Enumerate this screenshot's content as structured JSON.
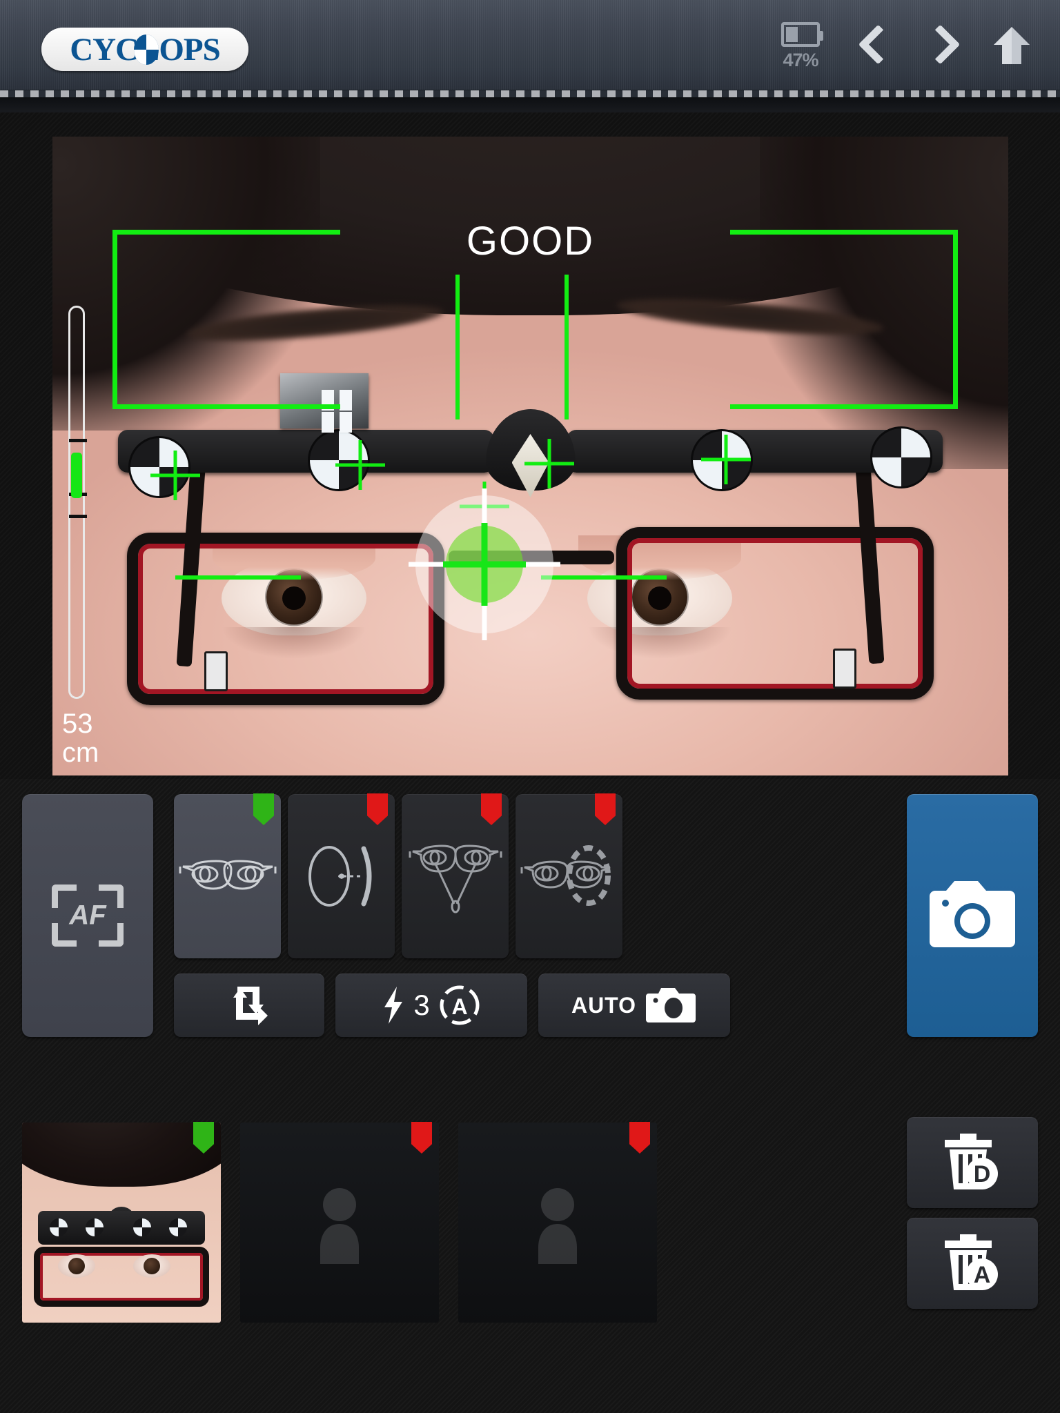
{
  "header": {
    "logo_text": "CYCLOPS",
    "logo_icon": "cyclops-eye-logo",
    "battery": {
      "icon": "battery-icon",
      "percent_label": "47%",
      "fill_percent": 47
    },
    "nav_prev_icon": "chevron-left-icon",
    "nav_next_icon": "chevron-right-icon",
    "home_icon": "home-icon"
  },
  "viewfinder": {
    "status_label": "GOOD",
    "distance_value": "53",
    "distance_unit": "cm",
    "overlay_color": "#12ed12",
    "target_icon": "crosshair-target",
    "gauge_icon": "distance-gauge",
    "frame_icon": "detection-bracket-frame"
  },
  "controls": {
    "af_label": "AF",
    "af_icon": "autofocus-frame-icon",
    "capture_icon": "camera-icon",
    "modes": [
      {
        "icon": "glasses-front-eyes-icon",
        "status": "green",
        "selected": true
      },
      {
        "icon": "lens-profile-icon",
        "status": "red",
        "selected": false
      },
      {
        "icon": "glasses-convergence-near-icon",
        "status": "red",
        "selected": false
      },
      {
        "icon": "glasses-dashed-pupil-icon",
        "status": "red",
        "selected": false
      }
    ],
    "buttons": [
      {
        "icon": "swap-arrows-icon",
        "label": ""
      },
      {
        "icon": "flash-auto-icon",
        "label": "3",
        "secondary_icon": "auto-circle-a-icon"
      },
      {
        "icon": "camera-small-icon",
        "label": "AUTO"
      }
    ]
  },
  "shots": {
    "items": [
      {
        "icon": "captured-photo-thumbnail",
        "status": "green",
        "has_photo": true
      },
      {
        "icon": "person-placeholder-icon",
        "status": "red",
        "has_photo": false
      },
      {
        "icon": "person-placeholder-icon",
        "status": "red",
        "has_photo": false
      }
    ],
    "delete_buttons": [
      {
        "icon": "trash-icon",
        "badge": "D"
      },
      {
        "icon": "trash-icon",
        "badge": "A"
      }
    ]
  },
  "colors": {
    "accent_blue": "#1d5e93",
    "status_good": "#2fb417",
    "status_bad": "#e01818",
    "overlay_green": "#12ed12",
    "logo_blue": "#0b5492"
  }
}
